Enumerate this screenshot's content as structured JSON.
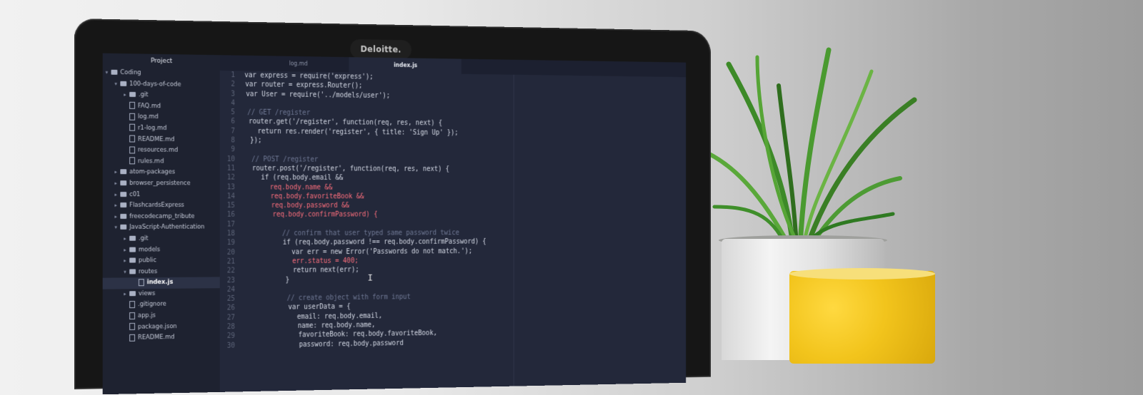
{
  "bezel_brand": "Deloitte.",
  "sidebar": {
    "title": "Project",
    "items": [
      {
        "label": "Coding",
        "kind": "folder",
        "depth": 0,
        "open": true
      },
      {
        "label": "100-days-of-code",
        "kind": "folder",
        "depth": 1,
        "open": true
      },
      {
        "label": ".git",
        "kind": "folder",
        "depth": 2,
        "open": false
      },
      {
        "label": "FAQ.md",
        "kind": "file",
        "depth": 2
      },
      {
        "label": "log.md",
        "kind": "file",
        "depth": 2
      },
      {
        "label": "r1-log.md",
        "kind": "file",
        "depth": 2
      },
      {
        "label": "README.md",
        "kind": "file",
        "depth": 2
      },
      {
        "label": "resources.md",
        "kind": "file",
        "depth": 2
      },
      {
        "label": "rules.md",
        "kind": "file",
        "depth": 2
      },
      {
        "label": "atom-packages",
        "kind": "folder",
        "depth": 1,
        "open": false
      },
      {
        "label": "browser_persistence",
        "kind": "folder",
        "depth": 1,
        "open": false
      },
      {
        "label": "c01",
        "kind": "folder",
        "depth": 1,
        "open": false
      },
      {
        "label": "FlashcardsExpress",
        "kind": "folder",
        "depth": 1,
        "open": false
      },
      {
        "label": "freecodecamp_tribute",
        "kind": "folder",
        "depth": 1,
        "open": false
      },
      {
        "label": "JavaScript-Authentication",
        "kind": "folder",
        "depth": 1,
        "open": true
      },
      {
        "label": ".git",
        "kind": "folder",
        "depth": 2,
        "open": false
      },
      {
        "label": "models",
        "kind": "folder",
        "depth": 2,
        "open": false
      },
      {
        "label": "public",
        "kind": "folder",
        "depth": 2,
        "open": false
      },
      {
        "label": "routes",
        "kind": "folder",
        "depth": 2,
        "open": true
      },
      {
        "label": "index.js",
        "kind": "file",
        "depth": 3,
        "selected": true
      },
      {
        "label": "views",
        "kind": "folder",
        "depth": 2,
        "open": false
      },
      {
        "label": ".gitignore",
        "kind": "file",
        "depth": 2
      },
      {
        "label": "app.js",
        "kind": "file",
        "depth": 2
      },
      {
        "label": "package.json",
        "kind": "file",
        "depth": 2
      },
      {
        "label": "README.md",
        "kind": "file",
        "depth": 2
      }
    ]
  },
  "tabs": [
    {
      "label": "log.md",
      "active": false
    },
    {
      "label": "index.js",
      "active": true
    }
  ],
  "code_lines": [
    {
      "n": "1",
      "text": "var express = require('express');",
      "indent": 0,
      "style": "normal"
    },
    {
      "n": "2",
      "text": "var router = express.Router();",
      "indent": 0,
      "style": "normal"
    },
    {
      "n": "3",
      "text": "var User = require('../models/user');",
      "indent": 0,
      "style": "normal"
    },
    {
      "n": "4",
      "text": "",
      "indent": 0,
      "style": "normal"
    },
    {
      "n": "5",
      "text": "// GET /register",
      "indent": 0,
      "style": "comment"
    },
    {
      "n": "6",
      "text": "router.get('/register', function(req, res, next) {",
      "indent": 0,
      "style": "normal"
    },
    {
      "n": "7",
      "text": "return res.render('register', { title: 'Sign Up' });",
      "indent": 1,
      "style": "normal"
    },
    {
      "n": "8",
      "text": "});",
      "indent": 0,
      "style": "normal"
    },
    {
      "n": "9",
      "text": "",
      "indent": 0,
      "style": "normal"
    },
    {
      "n": "10",
      "text": "// POST /register",
      "indent": 0,
      "style": "comment"
    },
    {
      "n": "11",
      "text": "router.post('/register', function(req, res, next) {",
      "indent": 0,
      "style": "normal"
    },
    {
      "n": "12",
      "text": "if (req.body.email &&",
      "indent": 1,
      "style": "normal"
    },
    {
      "n": "13",
      "text": "req.body.name &&",
      "indent": 2,
      "style": "red"
    },
    {
      "n": "14",
      "text": "req.body.favoriteBook &&",
      "indent": 2,
      "style": "red"
    },
    {
      "n": "15",
      "text": "req.body.password &&",
      "indent": 2,
      "style": "red"
    },
    {
      "n": "16",
      "text": "req.body.confirmPassword) {",
      "indent": 2,
      "style": "red"
    },
    {
      "n": "17",
      "text": "",
      "indent": 0,
      "style": "normal"
    },
    {
      "n": "18",
      "text": "// confirm that user typed same password twice",
      "indent": 3,
      "style": "comment"
    },
    {
      "n": "19",
      "text": "if (req.body.password !== req.body.confirmPassword) {",
      "indent": 3,
      "style": "normal"
    },
    {
      "n": "20",
      "text": "var err = new Error('Passwords do not match.');",
      "indent": 4,
      "style": "normal"
    },
    {
      "n": "21",
      "text": "err.status = 400;",
      "indent": 4,
      "style": "red"
    },
    {
      "n": "22",
      "text": "return next(err);",
      "indent": 4,
      "style": "normal"
    },
    {
      "n": "23",
      "text": "}",
      "indent": 3,
      "style": "normal"
    },
    {
      "n": "24",
      "text": "",
      "indent": 0,
      "style": "normal"
    },
    {
      "n": "25",
      "text": "// create object with form input",
      "indent": 3,
      "style": "comment"
    },
    {
      "n": "26",
      "text": "var userData = {",
      "indent": 3,
      "style": "normal"
    },
    {
      "n": "27",
      "text": "email: req.body.email,",
      "indent": 4,
      "style": "normal"
    },
    {
      "n": "28",
      "text": "name: req.body.name,",
      "indent": 4,
      "style": "normal"
    },
    {
      "n": "29",
      "text": "favoriteBook: req.body.favoriteBook,",
      "indent": 4,
      "style": "normal"
    },
    {
      "n": "30",
      "text": "password: req.body.password",
      "indent": 4,
      "style": "normal"
    }
  ],
  "colors": {
    "editor_bg": "#23283a",
    "sidebar_bg": "#1e2230",
    "comment": "#6f7894",
    "accent_red": "#ff6f7d",
    "plant_green": "#3f8f2a",
    "mug_yellow": "#f2c41c"
  }
}
